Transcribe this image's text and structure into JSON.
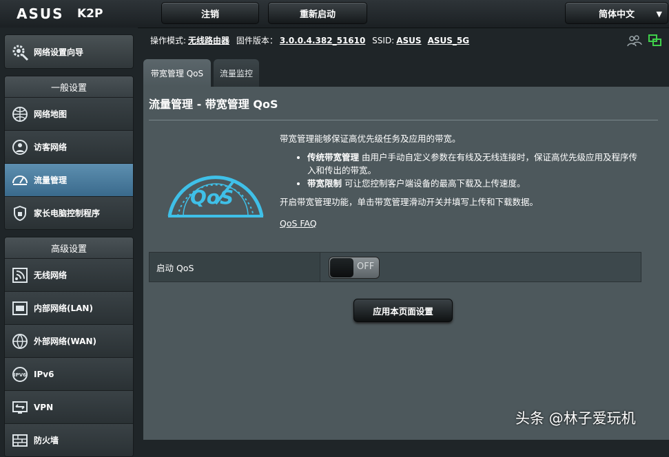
{
  "header": {
    "brand": "ASUS",
    "model": "K2P",
    "logout_label": "注销",
    "reboot_label": "重新启动",
    "language": "简体中文"
  },
  "sidebar": {
    "wizard_label": "网络设置向导",
    "general": {
      "title": "一般设置",
      "items": [
        {
          "label": "网络地图",
          "icon": "network-map-icon"
        },
        {
          "label": "访客网络",
          "icon": "guest-network-icon"
        },
        {
          "label": "流量管理",
          "icon": "traffic-manager-icon"
        },
        {
          "label": "家长电脑控制程序",
          "icon": "parental-control-icon"
        }
      ]
    },
    "advanced": {
      "title": "高级设置",
      "items": [
        {
          "label": "无线网络",
          "icon": "wireless-icon"
        },
        {
          "label": "内部网络(LAN)",
          "icon": "lan-icon"
        },
        {
          "label": "外部网络(WAN)",
          "icon": "wan-icon"
        },
        {
          "label": "IPv6",
          "icon": "ipv6-icon"
        },
        {
          "label": "VPN",
          "icon": "vpn-icon"
        },
        {
          "label": "防火墙",
          "icon": "firewall-icon"
        }
      ]
    }
  },
  "status": {
    "mode_label": "操作模式:",
    "mode_value": "无线路由器",
    "firmware_label": "固件版本：",
    "firmware_value": "3.0.0.4.382_51610",
    "ssid_label": "SSID:",
    "ssid1": "ASUS",
    "ssid2": "ASUS_5G"
  },
  "tabs": [
    {
      "label": "带宽管理 QoS"
    },
    {
      "label": "流量监控"
    }
  ],
  "main": {
    "title": "流量管理 - 带宽管理 QoS",
    "intro": "带宽管理能够保证高优先级任务及应用的带宽。",
    "bullet1_bold": "传统带宽管理",
    "bullet1_text": " 由用户手动自定义参数在有线及无线连接时，保证高优先级应用及程序传入和传出的带宽。",
    "bullet2_bold": "带宽限制",
    "bullet2_text": " 可让您控制客户端设备的最高下载及上传速度。",
    "instruction": "开启带宽管理功能，单击带宽管理滑动开关并填写上传和下载数据。",
    "faq_label": "QoS FAQ",
    "logo_text": "QoS",
    "qos_label": "启动 QoS",
    "qos_state": "OFF",
    "apply_label": "应用本页面设置"
  },
  "watermark": "头条 @林子爱玩机",
  "colors": {
    "accent": "#3a6a8c",
    "qos_logo": "#3fc0e8"
  }
}
